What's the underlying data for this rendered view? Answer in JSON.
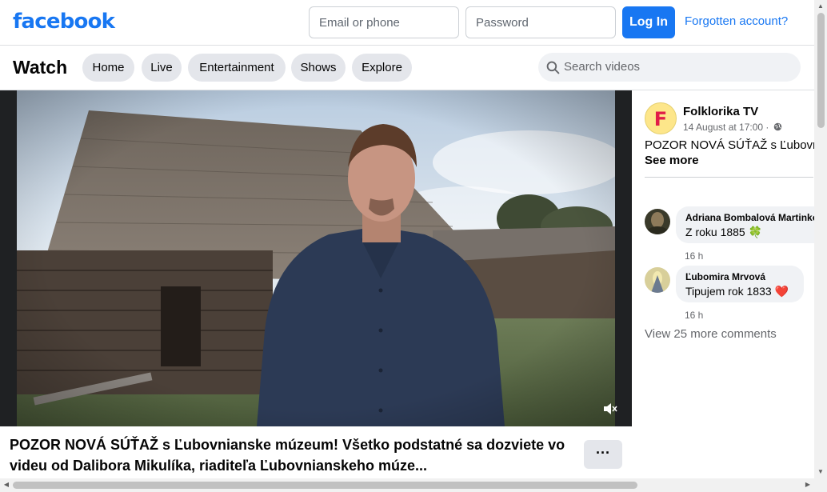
{
  "header": {
    "logo": "facebook",
    "email_placeholder": "Email or phone",
    "password_placeholder": "Password",
    "login_label": "Log In",
    "forgot_label": "Forgotten account?"
  },
  "watch": {
    "title": "Watch",
    "tabs": [
      "Home",
      "Live",
      "Entertainment",
      "Shows",
      "Explore"
    ],
    "search_placeholder": "Search videos"
  },
  "post": {
    "page_avatar_letter": "F",
    "page_name": "Folklorika TV",
    "time": "14 August at 17:00 ·",
    "privacy_icon": "globe-icon",
    "text": "POZOR NOVÁ SÚŤAŽ s Ľubovnianske múzeum!",
    "see_more": "See more"
  },
  "comments": [
    {
      "name": "Adriana Bombalová Martinková",
      "text": "Z roku 1885",
      "emoji": "🍀",
      "time": "16 h"
    },
    {
      "name": "Ľubomira Mrvová",
      "text": "Tipujem rok 1833",
      "emoji": "❤️",
      "time": "16 h"
    }
  ],
  "view_more_comments": "View 25 more comments",
  "caption": "POZOR NOVÁ SÚŤAŽ s Ľubovnianske múzeum! Všetko podstatné sa dozviete vo videu od Dalibora Mikulíka, riaditeľa Ľubovnianskeho múze...",
  "more_button": "···",
  "colors": {
    "brand": "#1877f2",
    "pill_bg": "#e4e6eb",
    "secondary_text": "#65676b"
  }
}
